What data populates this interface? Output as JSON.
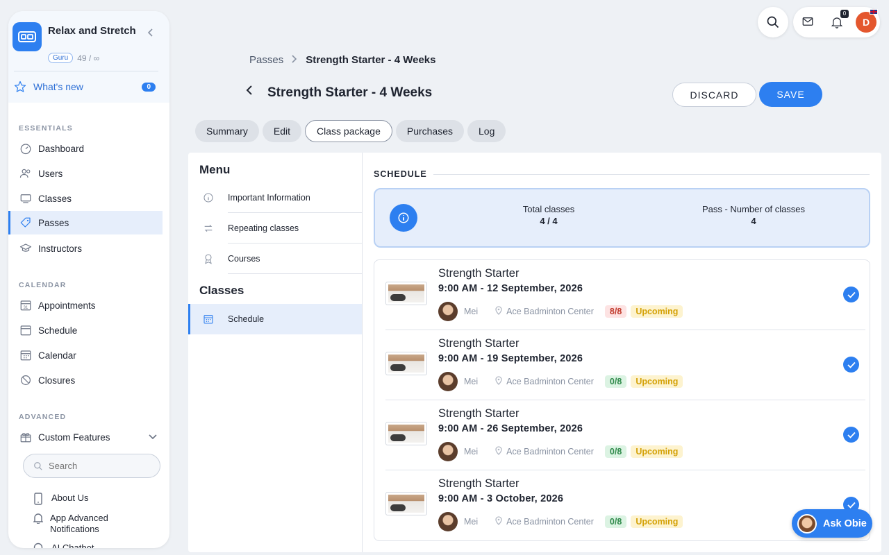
{
  "brand": {
    "name": "Relax and Stretch",
    "tier": "Guru",
    "usage": "49 / ∞"
  },
  "whats_new": {
    "label": "What's new",
    "count": "0"
  },
  "sidebar": {
    "essentials_title": "ESSENTIALS",
    "essentials": [
      {
        "label": "Dashboard",
        "icon": "dashboard-icon"
      },
      {
        "label": "Users",
        "icon": "users-icon"
      },
      {
        "label": "Classes",
        "icon": "classes-icon"
      },
      {
        "label": "Passes",
        "icon": "ticket-icon"
      },
      {
        "label": "Instructors",
        "icon": "graduation-cap-icon"
      }
    ],
    "calendar_title": "CALENDAR",
    "calendar": [
      {
        "label": "Appointments",
        "icon": "calendar-31-icon"
      },
      {
        "label": "Schedule",
        "icon": "calendar-icon"
      },
      {
        "label": "Calendar",
        "icon": "calendar-grid-icon"
      },
      {
        "label": "Closures",
        "icon": "ban-icon"
      }
    ],
    "advanced_title": "ADVANCED",
    "custom_features": "Custom Features",
    "search_placeholder": "Search",
    "sub_items": [
      {
        "label": "About Us",
        "icon": "phone-icon"
      },
      {
        "label": "App Advanced Notifications",
        "icon": "bell-icon"
      },
      {
        "label": "AI Chatbot",
        "icon": "chat-icon"
      }
    ]
  },
  "topbar": {
    "notification_count": "0",
    "user_initial": "D"
  },
  "breadcrumb": {
    "parent": "Passes",
    "current": "Strength Starter - 4 Weeks"
  },
  "page": {
    "title": "Strength Starter - 4 Weeks",
    "discard_label": "DISCARD",
    "save_label": "SAVE"
  },
  "tabs": [
    {
      "label": "Summary"
    },
    {
      "label": "Edit"
    },
    {
      "label": "Class package"
    },
    {
      "label": "Purchases"
    },
    {
      "label": "Log"
    }
  ],
  "menu": {
    "heading": "Menu",
    "items": [
      {
        "label": "Important Information",
        "icon": "info-icon"
      },
      {
        "label": "Repeating classes",
        "icon": "repeat-icon"
      },
      {
        "label": "Courses",
        "icon": "award-icon"
      }
    ],
    "classes_heading": "Classes",
    "classes_items": [
      {
        "label": "Schedule",
        "icon": "calendar-icon"
      }
    ]
  },
  "schedule": {
    "title": "SCHEDULE",
    "total_label": "Total classes",
    "total_value": "4 / 4",
    "pass_label": "Pass - Number of classes",
    "pass_value": "4",
    "classes": [
      {
        "name": "Strength Starter",
        "time": "9:00 AM - 12 September, 2026",
        "instructor": "Mei",
        "location": "Ace Badminton Center",
        "capacity": "8/8",
        "status": "Upcoming"
      },
      {
        "name": "Strength Starter",
        "time": "9:00 AM - 19 September, 2026",
        "instructor": "Mei",
        "location": "Ace Badminton Center",
        "capacity": "0/8",
        "status": "Upcoming"
      },
      {
        "name": "Strength Starter",
        "time": "9:00 AM - 26 September, 2026",
        "instructor": "Mei",
        "location": "Ace Badminton Center",
        "capacity": "0/8",
        "status": "Upcoming"
      },
      {
        "name": "Strength Starter",
        "time": "9:00 AM - 3 October, 2026",
        "instructor": "Mei",
        "location": "Ace Badminton Center",
        "capacity": "0/8",
        "status": "Upcoming"
      }
    ]
  },
  "ask_obie": {
    "label": "Ask Obie"
  },
  "colors": {
    "accent": "#2d7ff0",
    "full": "#c0392b",
    "open": "#2f8a4a",
    "upcoming": "#d4a106"
  }
}
